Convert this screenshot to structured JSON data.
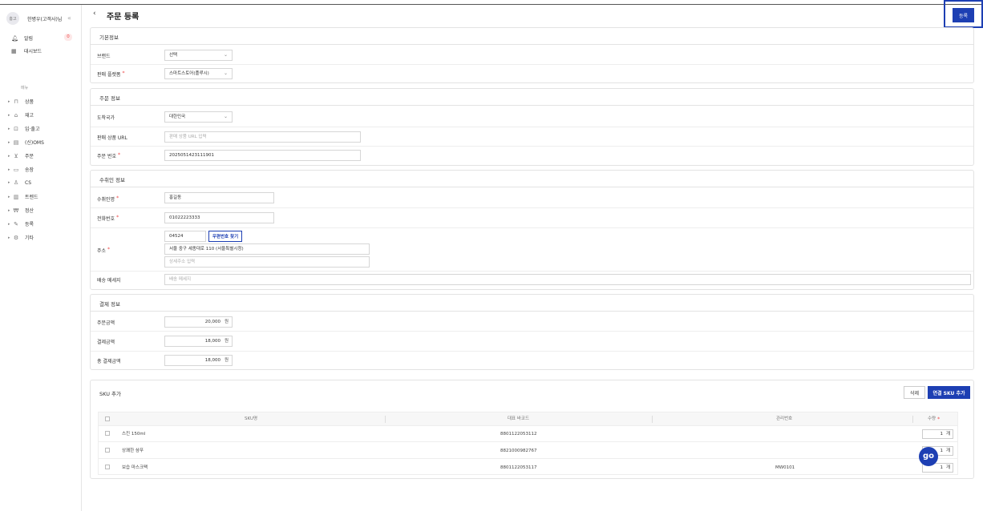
{
  "sidebar": {
    "avatar_text": "홍고",
    "user_name": "한병우(고객사)님",
    "collapse_icon": "double-chevron-left-icon",
    "notifications": {
      "label": "알림",
      "count": "0"
    },
    "dashboard": {
      "label": "대시보드"
    },
    "menu_header": "메뉴",
    "items": [
      {
        "label": "상품",
        "icon": "bag-icon"
      },
      {
        "label": "재고",
        "icon": "warehouse-icon"
      },
      {
        "label": "입·출고",
        "icon": "truck-icon"
      },
      {
        "label": "(신)OMS",
        "icon": "document-icon"
      },
      {
        "label": "주문",
        "icon": "cart-icon"
      },
      {
        "label": "송장",
        "icon": "invoice-icon"
      },
      {
        "label": "CS",
        "icon": "person-icon"
      },
      {
        "label": "트렌드",
        "icon": "chart-icon"
      },
      {
        "label": "정산",
        "icon": "won-icon"
      },
      {
        "label": "등록",
        "icon": "pencil-icon"
      },
      {
        "label": "기타",
        "icon": "gear-icon"
      }
    ]
  },
  "header": {
    "back": "‹",
    "title": "주문 등록",
    "register_label": "등록"
  },
  "basic": {
    "title": "기본정보",
    "brand_label": "브랜드",
    "brand_value": "선택",
    "platform_label": "판매 플랫폼",
    "platform_value": "스마트스토어(플루시)"
  },
  "order": {
    "title": "주문 정보",
    "country_label": "도착국가",
    "country_value": "대한민국",
    "url_label": "판매 상품 URL",
    "url_placeholder": "판매 상품 URL 입력",
    "order_no_label": "주문 번호",
    "order_no_value": "2025051423111901"
  },
  "recipient": {
    "title": "수취인 정보",
    "name_label": "수취인명",
    "name_value": "홍길동",
    "phone_label": "전화번호",
    "phone_value": "01022223333",
    "address_label": "주소",
    "zip_value": "04524",
    "zip_button": "우편번호 찾기",
    "address1": "서울 중구 세종대로 110 (서울특별시청)",
    "address2_placeholder": "상세주소 입력",
    "message_label": "배송 메세지",
    "message_placeholder": "배송 메세지"
  },
  "payment": {
    "title": "결제 정보",
    "order_amount_label": "주문금액",
    "order_amount": "20,000",
    "paid_amount_label": "결제금액",
    "paid_amount": "18,000",
    "total_label": "총 결제금액",
    "total_amount": "18,000",
    "unit": "원"
  },
  "sku": {
    "title": "SKU 추가",
    "delete_label": "삭제",
    "add_label": "연결 SKU 추가",
    "columns": {
      "name": "SKU명",
      "barcode": "대표 바코드",
      "mgmt": "관리번호",
      "qty": "수량"
    },
    "qty_unit": "개",
    "rows": [
      {
        "name": "스킨 150ml",
        "barcode": "8801122053112",
        "mgmt": "",
        "qty": "1"
      },
      {
        "name": "상쾌한 샴푸",
        "barcode": "8821000982767",
        "mgmt": "",
        "qty": "1"
      },
      {
        "name": "보습 마스크팩",
        "barcode": "8801122053117",
        "mgmt": "MW0101",
        "qty": "1"
      }
    ]
  },
  "fab_text": "go"
}
